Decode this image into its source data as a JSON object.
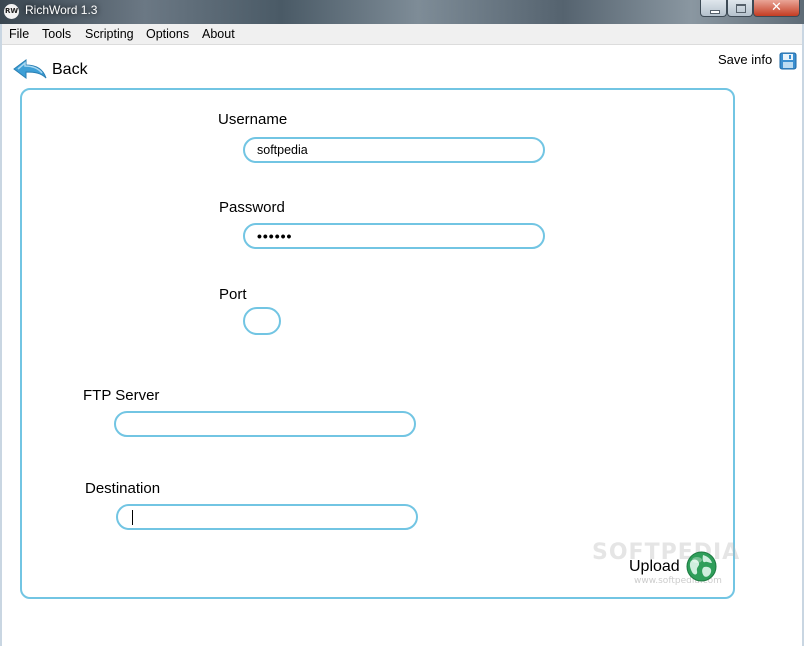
{
  "window": {
    "title": "RichWord 1.3",
    "app_icon_text": "RW",
    "close_glyph": "✕"
  },
  "menu": {
    "items": [
      "File",
      "Tools",
      "Scripting",
      "Options",
      "About"
    ]
  },
  "toolbar": {
    "back_label": "Back",
    "save_info_label": "Save info"
  },
  "form": {
    "username": {
      "label": "Username",
      "value": "softpedia"
    },
    "password": {
      "label": "Password",
      "value": "••••••"
    },
    "port": {
      "label": "Port",
      "value": ""
    },
    "ftp_server": {
      "label": "FTP Server",
      "value": ""
    },
    "destination": {
      "label": "Destination",
      "value": ""
    }
  },
  "actions": {
    "upload_label": "Upload"
  },
  "watermark": {
    "text": "SOFTPEDIA",
    "sub": "www.softpedia.com"
  },
  "colors": {
    "accent": "#72c5e3",
    "back_arrow": "#3d9fd6",
    "upload_icon": "#2f9e5a"
  },
  "icons": [
    "back-arrow-icon",
    "floppy-disk-icon",
    "globe-icon"
  ]
}
